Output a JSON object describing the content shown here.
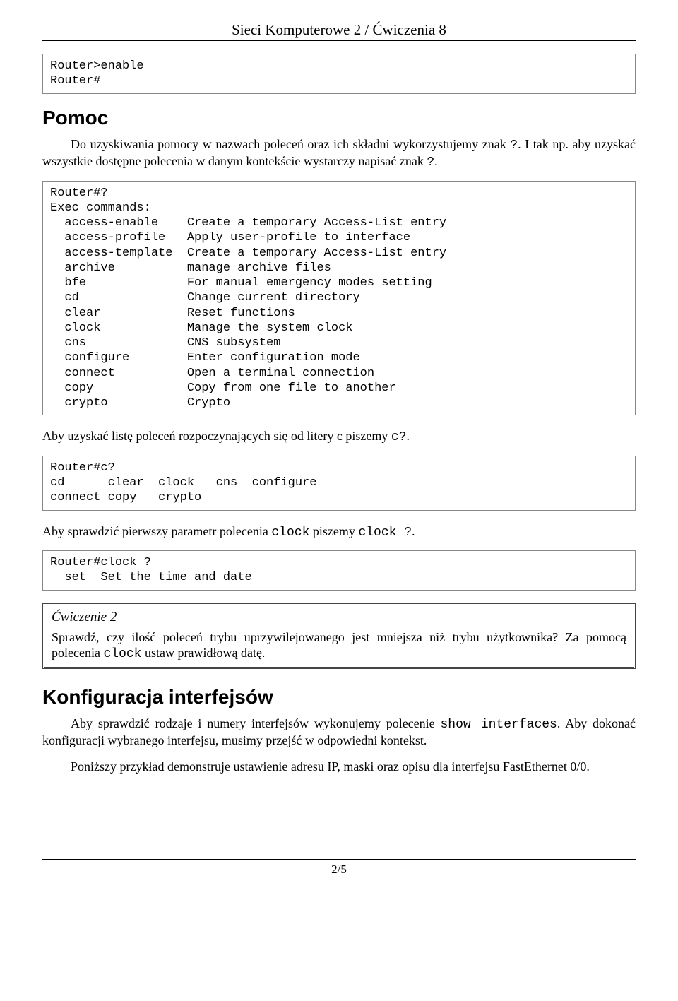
{
  "header": {
    "title": "Sieci Komputerowe 2 / Ćwiczenia 8"
  },
  "codebox1": "Router>enable\nRouter#",
  "section_pomoc": "Pomoc",
  "para1_a": "Do uzyskiwania pomocy w nazwach poleceń oraz ich składni wykorzystujemy znak ",
  "para1_b": ". I tak np. aby uzyskać wszystkie dostępne polecenia w danym kontekście wystarczy napisać znak ",
  "para1_c": ".",
  "qmark": "?",
  "codebox2": "Router#?\nExec commands:\n  access-enable    Create a temporary Access-List entry\n  access-profile   Apply user-profile to interface\n  access-template  Create a temporary Access-List entry\n  archive          manage archive files\n  bfe              For manual emergency modes setting\n  cd               Change current directory\n  clear            Reset functions\n  clock            Manage the system clock\n  cns              CNS subsystem\n  configure        Enter configuration mode\n  connect          Open a terminal connection\n  copy             Copy from one file to another\n  crypto           Crypto",
  "para2_a": "Aby uzyskać listę poleceń rozpoczynających się od litery c piszemy ",
  "para2_code": "c?",
  "para2_b": ".",
  "codebox3": "Router#c?\ncd      clear  clock   cns  configure\nconnect copy   crypto",
  "para3_a": "Aby sprawdzić pierwszy parametr polecenia ",
  "para3_code1": "clock",
  "para3_b": " piszemy ",
  "para3_code2": "clock ?",
  "para3_c": ".",
  "codebox4": "Router#clock ?\n  set  Set the time and date",
  "exercise2": {
    "title": "Ćwiczenie 2",
    "body_a": "Sprawdź, czy ilość poleceń trybu uprzywilejowanego jest mniejsza niż trybu użytkownika? Za pomocą polecenia ",
    "body_code": "clock",
    "body_b": " ustaw prawidłową datę."
  },
  "section_konfig": "Konfiguracja interfejsów",
  "para4_a": "Aby sprawdzić rodzaje i numery interfejsów wykonujemy polecenie ",
  "para4_code": "show interfaces",
  "para4_b": ". Aby dokonać konfiguracji wybranego interfejsu, musimy przejść w odpowiedni kontekst.",
  "para5": "Poniższy przykład demonstruje ustawienie adresu IP, maski oraz opisu dla interfejsu FastEthernet 0/0.",
  "footer": "2/5"
}
